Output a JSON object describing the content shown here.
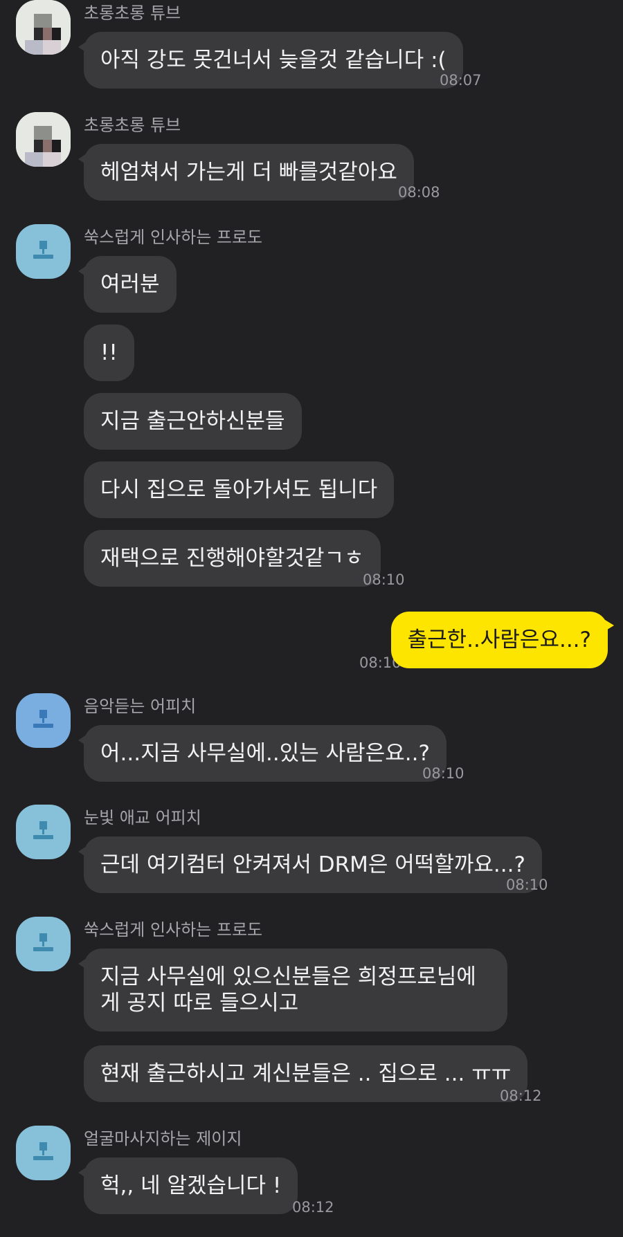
{
  "colors": {
    "background": "#212124",
    "bubble_other": "#3a3a3d",
    "bubble_mine": "#fee500",
    "sender_text": "#a6a6aa",
    "time_text": "#9a9a9e"
  },
  "messages": [
    {
      "sender": "초롱초롱 튜브",
      "avatar": "pixelated-photo",
      "bubbles": [
        "아직 강도 못건너서 늦을것 같습니다 :("
      ],
      "time": "08:07"
    },
    {
      "sender": "초롱초롱 튜브",
      "avatar": "pixelated-photo",
      "bubbles": [
        "헤엄쳐서 가는게 더 빠를것같아요"
      ],
      "time": "08:08"
    },
    {
      "sender": "쑥스럽게 인사하는 프로도",
      "avatar": "default-person-icon",
      "bubbles": [
        "여러분",
        "!!",
        "지금 출근안하신분들",
        "다시 집으로 돌아가셔도 됩니다",
        "재택으로 진행해야할것같ㄱㅎ"
      ],
      "time": "08:10"
    },
    {
      "sender": "",
      "mine": true,
      "bubbles": [
        "출근한..사람은요...?"
      ],
      "time": "08:10"
    },
    {
      "sender": "음악듣는 어피치",
      "avatar": "default-person-icon",
      "bubbles": [
        "어...지금 사무실에..있는 사람은요..?"
      ],
      "time": "08:10"
    },
    {
      "sender": "눈빛 애교 어피치",
      "avatar": "default-person-icon",
      "bubbles": [
        "근데 여기컴터 안켜져서 DRM은 어떡할까요...?"
      ],
      "time": "08:10"
    },
    {
      "sender": "쑥스럽게 인사하는 프로도",
      "avatar": "default-person-icon",
      "bubbles": [
        "지금 사무실에 있으신분들은 희정프로님에게 공지 따로 들으시고",
        "현재 출근하시고 계신분들은 .. 집으로 ... ㅠㅠ"
      ],
      "time": "08:12"
    },
    {
      "sender": "얼굴마사지하는 제이지",
      "avatar": "default-person-icon",
      "bubbles": [
        "헉,, 네 알겠습니다 !"
      ],
      "time": "08:12"
    }
  ]
}
